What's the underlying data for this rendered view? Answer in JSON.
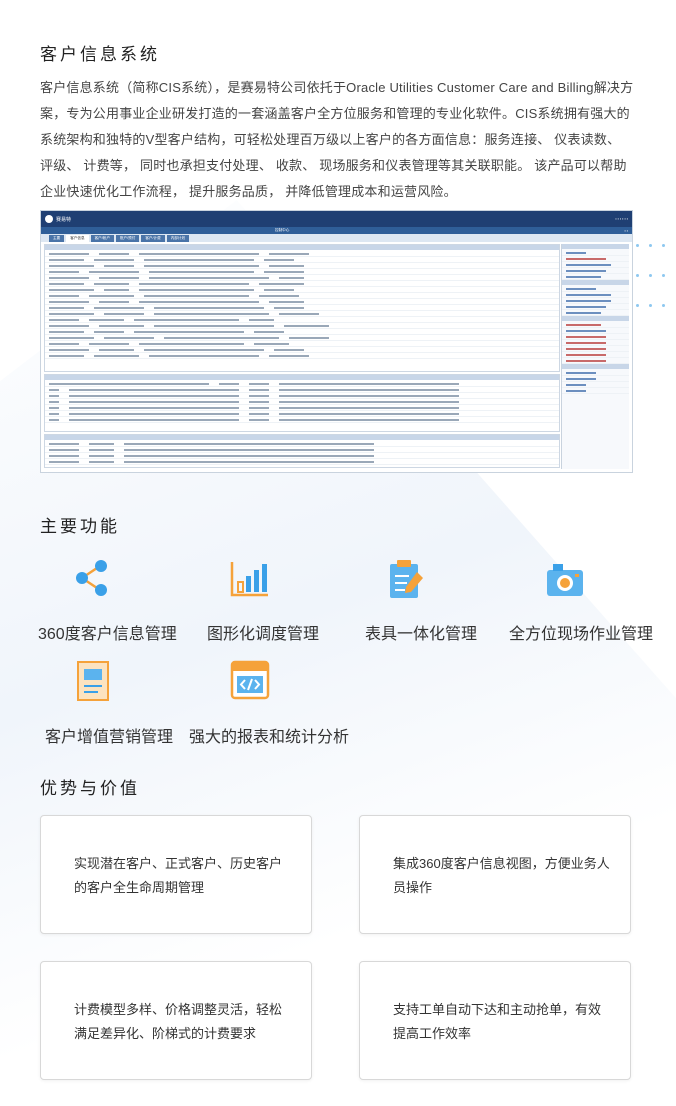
{
  "header": {
    "title": "客户信息系统",
    "intro": "客户信息系统（简称CIS系统），是赛易特公司依托于Oracle Utilities Customer Care and Billing解决方案，专为公用事业企业研发打造的一套涵盖客户全方位服务和管理的专业化软件。CIS系统拥有强大的系统架构和独特的V型客户结构，可轻松处理百万级以上客户的各方面信息：服务连接、 仪表读数、 评级、 计费等， 同时也承担支付处理、 收款、 现场服务和仪表管理等其关联职能。 该产品可以帮助企业快速优化工作流程， 提升服务品质， 并降低管理成本和运营风险。"
  },
  "screenshot": {
    "logo_text": "赛易特",
    "menu_title": "控制中心",
    "tabs": [
      "主要",
      "客户信息",
      "客户/帐户",
      "账户/预付",
      "客户/计费",
      "内部计划"
    ]
  },
  "features": {
    "title": "主要功能",
    "items": [
      {
        "label": "360度客户信息管理",
        "icon": "network-icon"
      },
      {
        "label": "图形化调度管理",
        "icon": "bar-chart-icon"
      },
      {
        "label": "表具一体化管理",
        "icon": "clipboard-icon"
      },
      {
        "label": "全方位现场作业管理",
        "icon": "camera-icon"
      },
      {
        "label": "客户增值营销管理",
        "icon": "document-icon"
      },
      {
        "label": "强大的报表和统计分析",
        "icon": "code-window-icon"
      }
    ]
  },
  "advantages": {
    "title": "优势与价值",
    "cards": [
      "实现潜在客户、正式客户、历史客户的客户全生命周期管理",
      "集成360度客户信息视图，方便业务人员操作",
      "计费模型多样、价格调整灵活，轻松满足差异化、阶梯式的计费要求",
      "支持工单自动下达和主动抢单，有效提高工作效率"
    ]
  },
  "colors": {
    "icon_orange": "#f5a23a",
    "icon_blue": "#3aa0e8",
    "header_navy": "#1f3f73"
  }
}
